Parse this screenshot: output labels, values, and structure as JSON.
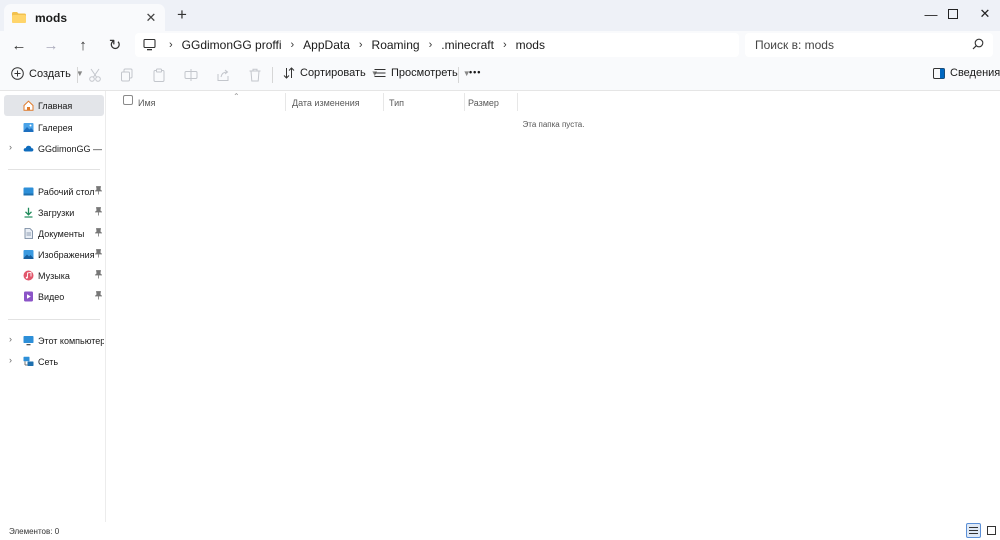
{
  "tab": {
    "title": "mods",
    "close_glyph": "✕",
    "new_tab_glyph": "+"
  },
  "window_controls": {
    "minimize": "—",
    "maximize": "☐",
    "close": "✕"
  },
  "nav": {
    "back": "←",
    "forward": "→",
    "up": "↑",
    "refresh": "↻"
  },
  "address": {
    "crumbs": [
      "GGdimonGG proffi",
      "AppData",
      "Roaming",
      ".minecraft",
      "mods"
    ],
    "separator": "›"
  },
  "search": {
    "placeholder": "Поиск в: mods"
  },
  "commands": {
    "create": "Создать",
    "sort": "Сортировать",
    "view": "Просмотреть",
    "more": "•••",
    "details": "Сведения"
  },
  "sidebar": {
    "items": [
      {
        "label": "Главная",
        "icon": "home-icon",
        "selected": true
      },
      {
        "label": "Галерея",
        "icon": "gallery-icon"
      },
      {
        "label": "GGdimonGG — Личное",
        "icon": "onedrive-icon",
        "expandable": true
      },
      {
        "label": "Рабочий стол",
        "icon": "desktop-icon",
        "pinned": true
      },
      {
        "label": "Загрузки",
        "icon": "downloads-icon",
        "pinned": true
      },
      {
        "label": "Документы",
        "icon": "documents-icon",
        "pinned": true
      },
      {
        "label": "Изображения",
        "icon": "pictures-icon",
        "pinned": true
      },
      {
        "label": "Музыка",
        "icon": "music-icon",
        "pinned": true
      },
      {
        "label": "Видео",
        "icon": "videos-icon",
        "pinned": true
      },
      {
        "label": "Этот компьютер",
        "icon": "this-pc-icon",
        "expandable": true
      },
      {
        "label": "Сеть",
        "icon": "network-icon",
        "expandable": true
      }
    ]
  },
  "columns": [
    "Имя",
    "Дата изменения",
    "Тип",
    "Размер"
  ],
  "empty_message": "Эта папка пуста.",
  "status": {
    "items_count": "Элементов: 0"
  },
  "colors": {
    "accent": "#0067c0",
    "folder": "#f2c14e",
    "selected_bg": "#e3e5e9"
  }
}
